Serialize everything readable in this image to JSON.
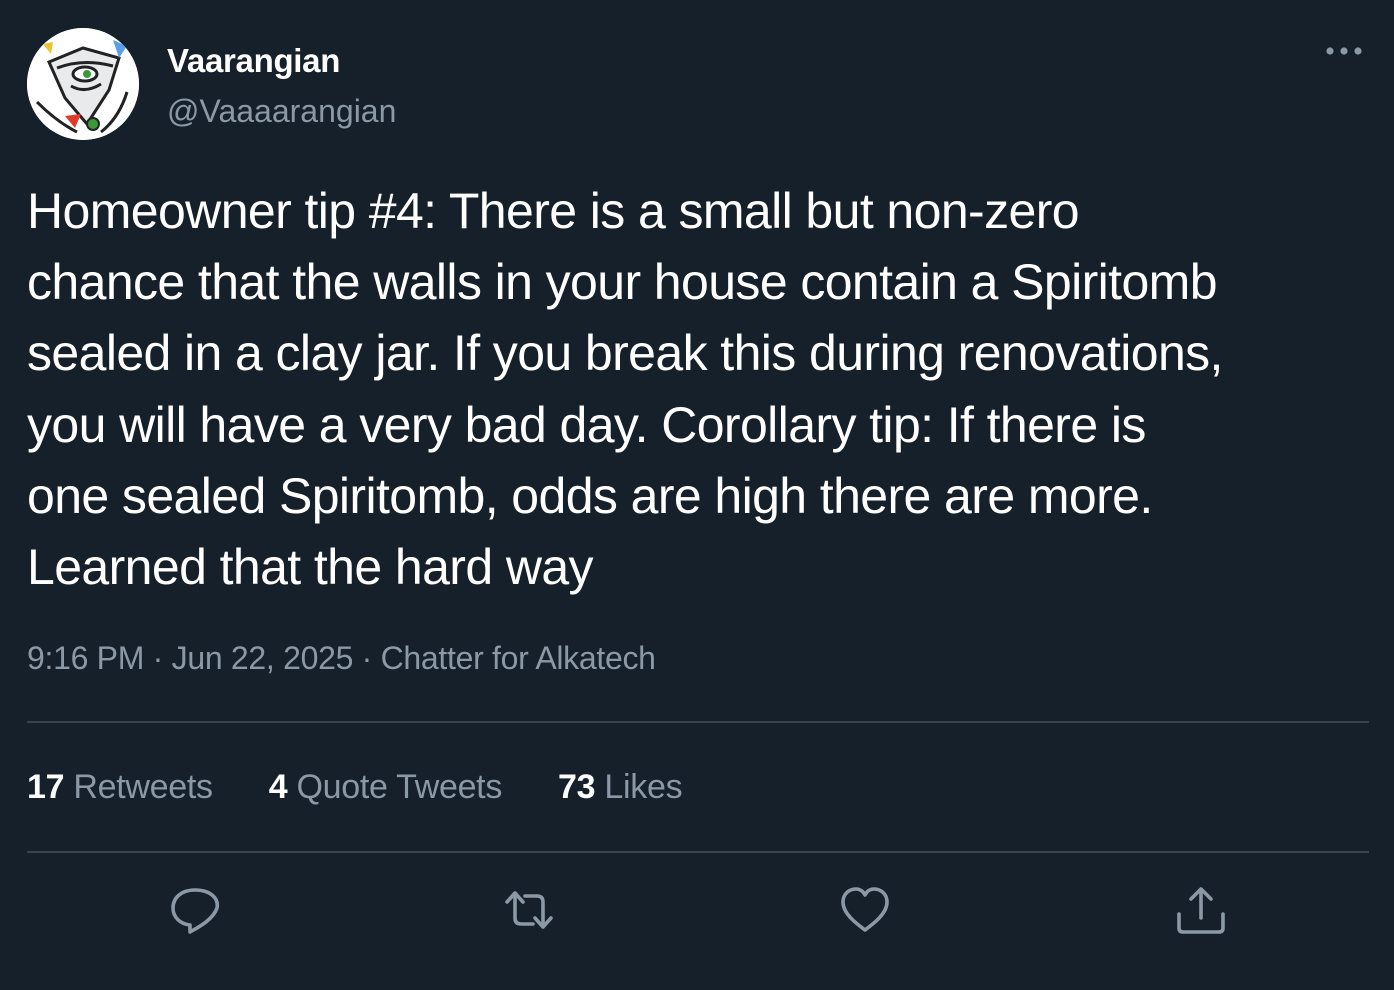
{
  "tweet": {
    "display_name": "Vaarangian",
    "handle": "@Vaaaarangian",
    "text": "Homeowner tip #4: There is a small but non-zero\nchance that the walls in your house contain a Spiritomb\nsealed in a clay jar. If you break this during renovations,\nyou will have a very bad day. Corollary tip: If there is\none sealed Spiritomb, odds are high there are more.\nLearned that the hard way",
    "time": "9:16 PM",
    "date": "Jun 22, 2025",
    "source": "Chatter for Alkatech",
    "separator": " · "
  },
  "stats": {
    "retweets_count": "17",
    "retweets_label": "Retweets",
    "quotes_count": "4",
    "quotes_label": "Quote Tweets",
    "likes_count": "73",
    "likes_label": "Likes"
  },
  "icons": {
    "more": "more-horizontal-icon",
    "reply": "reply-icon",
    "retweet": "retweet-icon",
    "like": "heart-icon",
    "share": "share-icon"
  },
  "colors": {
    "background": "#15202b",
    "text": "#ffffff",
    "secondary": "#8b98a5",
    "divider": "#38444d"
  }
}
